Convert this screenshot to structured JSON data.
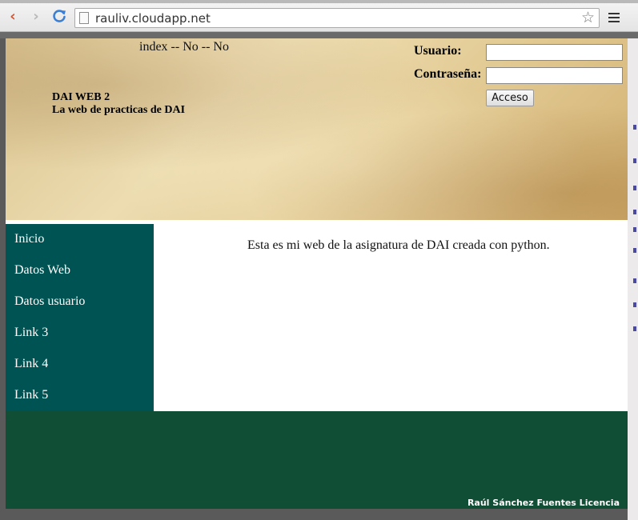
{
  "browser": {
    "url": "rauliv.cloudapp.net",
    "back_icon": "‹",
    "forward_icon": "›",
    "star_icon": "☆"
  },
  "header": {
    "status": "index -- No -- No",
    "title": "DAI WEB 2",
    "subtitle": "La web de practicas de DAI"
  },
  "login": {
    "user_label": "Usuario:",
    "password_label": "Contraseña:",
    "user_value": "",
    "password_value": "",
    "submit_label": "Acceso"
  },
  "sidebar": {
    "items": [
      {
        "label": "Inicio"
      },
      {
        "label": "Datos Web"
      },
      {
        "label": "Datos usuario"
      },
      {
        "label": "Link 3"
      },
      {
        "label": "Link 4"
      },
      {
        "label": "Link 5"
      }
    ]
  },
  "content": {
    "text": "Esta es mi web de la asignatura de DAI creada con python."
  },
  "footer": {
    "text": "Raúl Sánchez Fuentes Licencia"
  },
  "colors": {
    "sidebar_bg": "#005353",
    "footer_bg": "#114e36",
    "back_accent": "#d9542e",
    "reload_accent": "#3b7fd4"
  }
}
